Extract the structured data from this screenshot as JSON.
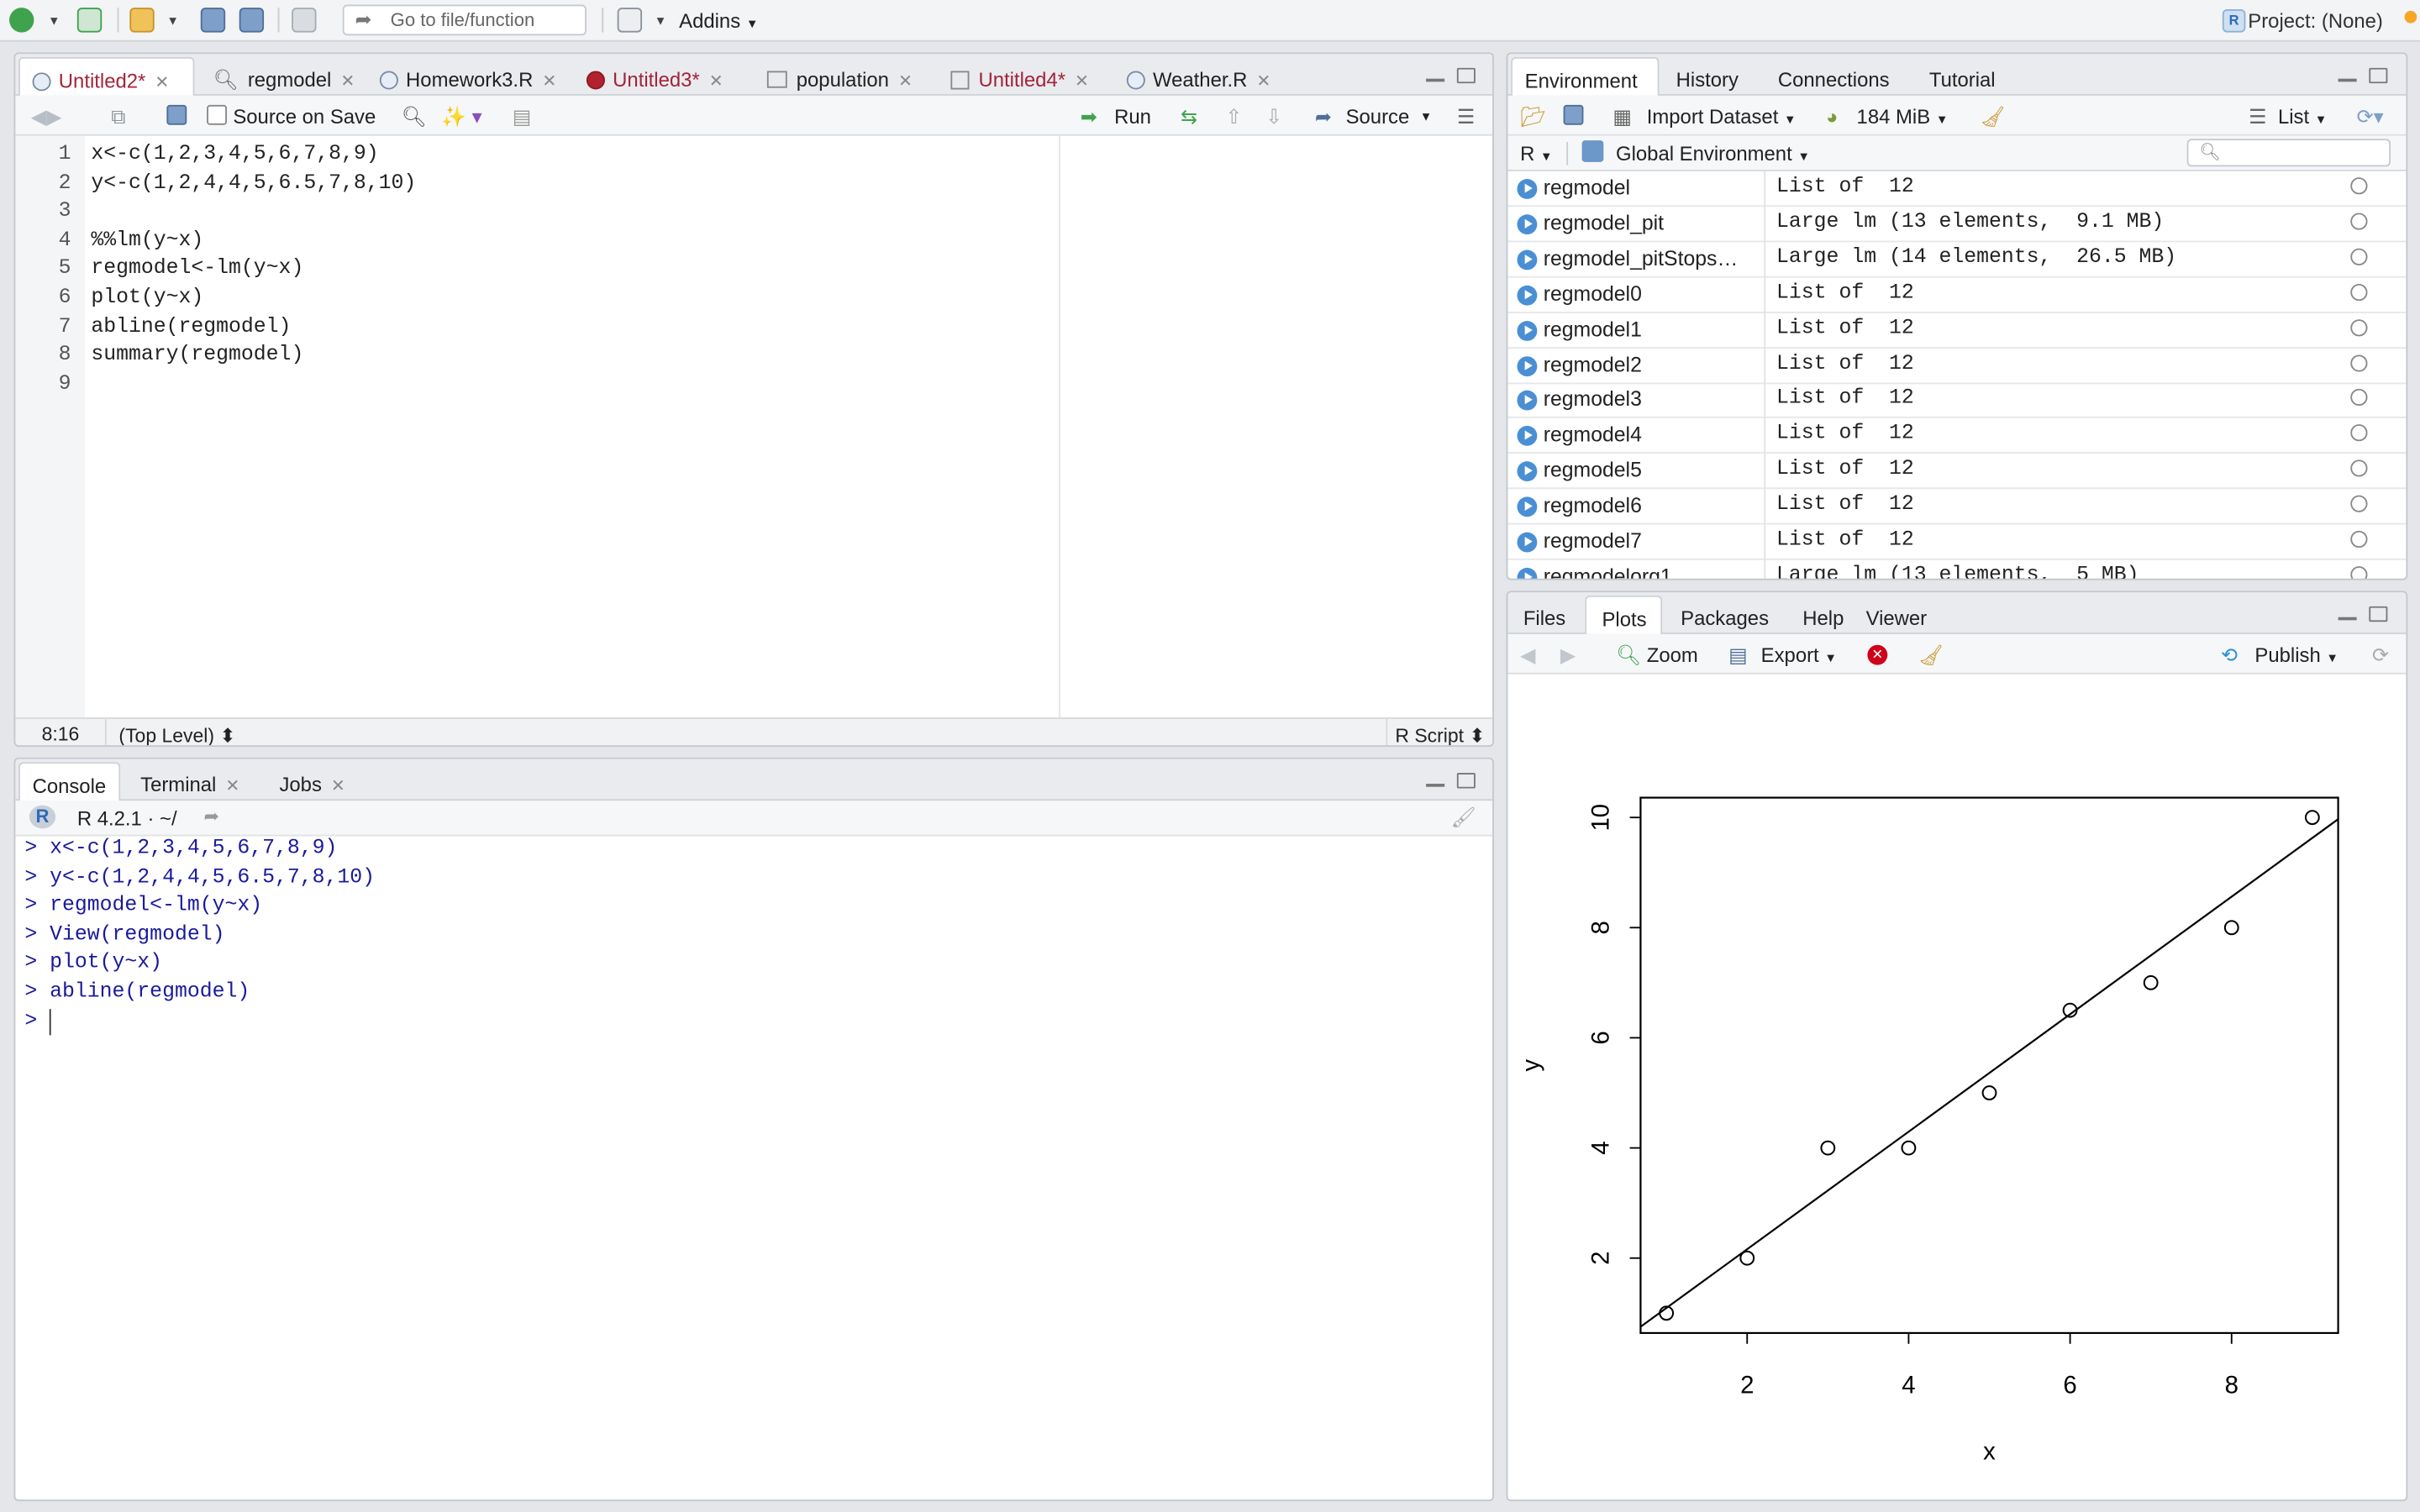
{
  "topbar": {
    "goto_placeholder": "Go to file/function",
    "addins": "Addins",
    "project": "Project: (None)"
  },
  "editor": {
    "tabs": [
      {
        "label": "Untitled2",
        "modified": "*"
      },
      {
        "label": "regmodel"
      },
      {
        "label": "Homework3.R"
      },
      {
        "label": "Untitled3",
        "modified": "*"
      },
      {
        "label": "population"
      },
      {
        "label": "Untitled4",
        "modified": "*"
      },
      {
        "label": "Weather.R"
      }
    ],
    "source_on_save": "Source on Save",
    "run": "Run",
    "source": "Source",
    "lines": [
      {
        "n": "1",
        "code": "x<-c(1,2,3,4,5,6,7,8,9)"
      },
      {
        "n": "2",
        "code": "y<-c(1,2,4,4,5,6.5,7,8,10)"
      },
      {
        "n": "3",
        "code": ""
      },
      {
        "n": "4",
        "code": "%%lm(y~x)"
      },
      {
        "n": "5",
        "code": "regmodel<-lm(y~x)"
      },
      {
        "n": "6",
        "code": "plot(y~x)"
      },
      {
        "n": "7",
        "code": "abline(regmodel)"
      },
      {
        "n": "8",
        "code": "summary(regmodel)"
      },
      {
        "n": "9",
        "code": ""
      }
    ],
    "status_pos": "8:16",
    "status_scope": "(Top Level)",
    "status_type": "R Script"
  },
  "console": {
    "tabs": [
      "Console",
      "Terminal",
      "Jobs"
    ],
    "version": "R 4.2.1 · ~/",
    "lines": [
      "> x<-c(1,2,3,4,5,6,7,8,9)",
      "> y<-c(1,2,4,4,5,6.5,7,8,10)",
      "> regmodel<-lm(y~x)",
      "> View(regmodel)",
      "> plot(y~x)",
      "> abline(regmodel)",
      ">"
    ]
  },
  "env": {
    "tabs": [
      "Environment",
      "History",
      "Connections",
      "Tutorial"
    ],
    "import_dataset": "Import Dataset",
    "memory": "184 MiB",
    "view_mode": "List",
    "lang": "R",
    "scope": "Global Environment",
    "rows": [
      {
        "name": "regmodel",
        "value": "List of  12"
      },
      {
        "name": "regmodel_pit",
        "value": "Large lm (13 elements,  9.1 MB)"
      },
      {
        "name": "regmodel_pitStops…",
        "value": "Large lm (14 elements,  26.5 MB)"
      },
      {
        "name": "regmodel0",
        "value": "List of  12"
      },
      {
        "name": "regmodel1",
        "value": "List of  12"
      },
      {
        "name": "regmodel2",
        "value": "List of  12"
      },
      {
        "name": "regmodel3",
        "value": "List of  12"
      },
      {
        "name": "regmodel4",
        "value": "List of  12"
      },
      {
        "name": "regmodel5",
        "value": "List of  12"
      },
      {
        "name": "regmodel6",
        "value": "List of  12"
      },
      {
        "name": "regmodel7",
        "value": "List of  12"
      },
      {
        "name": "regmodelorg1",
        "value": "Large lm (13 elements,  5 MB)"
      }
    ]
  },
  "plots": {
    "tabs": [
      "Files",
      "Plots",
      "Packages",
      "Help",
      "Viewer"
    ],
    "zoom": "Zoom",
    "export": "Export",
    "publish": "Publish"
  },
  "chart_data": {
    "type": "scatter",
    "xlabel": "x",
    "ylabel": "y",
    "x": [
      1,
      2,
      3,
      4,
      5,
      6,
      7,
      8,
      9
    ],
    "y": [
      1,
      2,
      4,
      4,
      5,
      6.5,
      7,
      8,
      10
    ],
    "xticks": [
      "2",
      "4",
      "6",
      "8"
    ],
    "yticks": [
      "2",
      "4",
      "6",
      "8",
      "10"
    ],
    "xlim": [
      0.68,
      9.32
    ],
    "ylim": [
      0.64,
      10.36
    ],
    "fit_line": {
      "intercept": 0.0278,
      "slope": 1.0667
    },
    "grid": false
  }
}
